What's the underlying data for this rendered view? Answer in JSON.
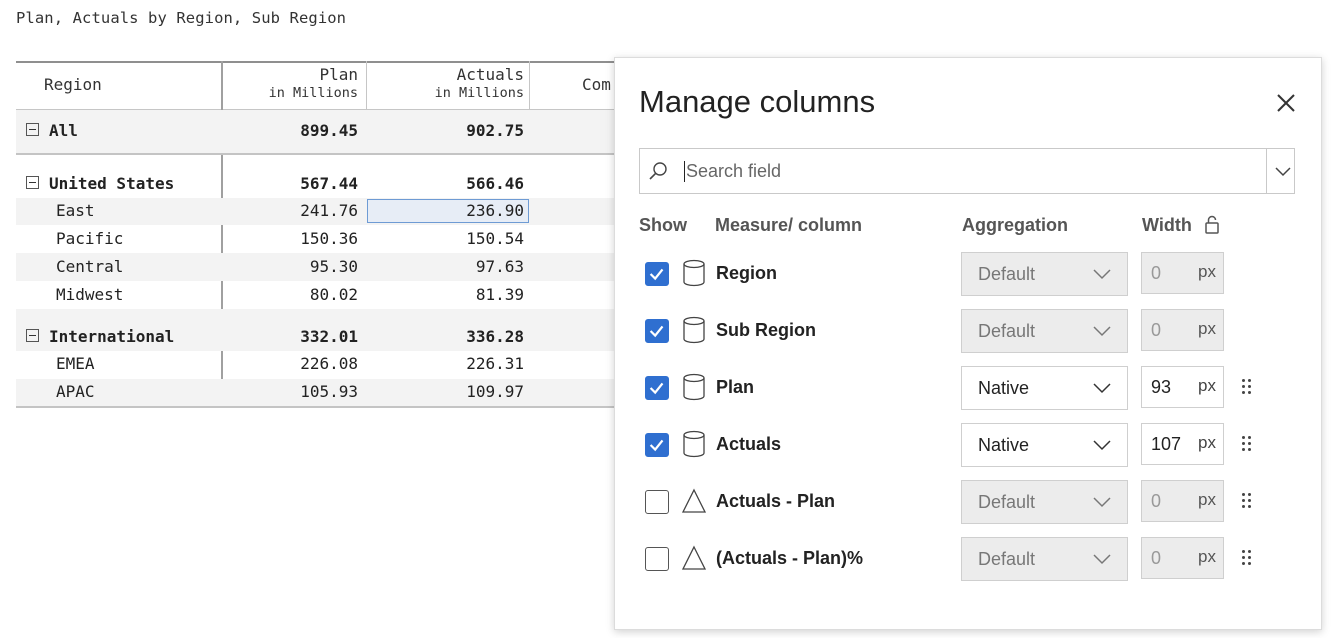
{
  "report": {
    "title": "Plan, Actuals by Region, Sub Region"
  },
  "table": {
    "columns": [
      {
        "label": "Region",
        "sub": ""
      },
      {
        "label": "Plan",
        "sub": "in Millions"
      },
      {
        "label": "Actuals",
        "sub": "in Millions"
      },
      {
        "label": "Com",
        "sub": ""
      }
    ],
    "rows": [
      {
        "name": "All",
        "plan": "899.45",
        "actuals": "902.75"
      },
      {
        "name": "United States",
        "plan": "567.44",
        "actuals": "566.46"
      },
      {
        "name": "East",
        "plan": "241.76",
        "actuals": "236.90"
      },
      {
        "name": "Pacific",
        "plan": "150.36",
        "actuals": "150.54"
      },
      {
        "name": "Central",
        "plan": "95.30",
        "actuals": "97.63"
      },
      {
        "name": "Midwest",
        "plan": "80.02",
        "actuals": "81.39"
      },
      {
        "name": "International",
        "plan": "332.01",
        "actuals": "336.28"
      },
      {
        "name": "EMEA",
        "plan": "226.08",
        "actuals": "226.31"
      },
      {
        "name": "APAC",
        "plan": "105.93",
        "actuals": "109.97"
      }
    ]
  },
  "panel": {
    "title": "Manage columns",
    "search": {
      "placeholder": "Search field",
      "value": ""
    },
    "headers": {
      "show": "Show",
      "measure": "Measure/ column",
      "aggregation": "Aggregation",
      "width": "Width"
    },
    "fields": [
      {
        "name": "Region",
        "checked": true,
        "icon": "cylinder-icon",
        "aggregation": "Default",
        "width": "0",
        "unit": "px",
        "enabled": false
      },
      {
        "name": "Sub Region",
        "checked": true,
        "icon": "cylinder-icon",
        "aggregation": "Default",
        "width": "0",
        "unit": "px",
        "enabled": false
      },
      {
        "name": "Plan",
        "checked": true,
        "icon": "cylinder-icon",
        "aggregation": "Native",
        "width": "93",
        "unit": "px",
        "enabled": true
      },
      {
        "name": "Actuals",
        "checked": true,
        "icon": "cylinder-icon",
        "aggregation": "Native",
        "width": "107",
        "unit": "px",
        "enabled": true
      },
      {
        "name": "Actuals - Plan",
        "checked": false,
        "icon": "triangle-icon",
        "aggregation": "Default",
        "width": "0",
        "unit": "px",
        "enabled": false
      },
      {
        "name": "(Actuals - Plan)%",
        "checked": false,
        "icon": "triangle-icon",
        "aggregation": "Default",
        "width": "0",
        "unit": "px",
        "enabled": false
      }
    ]
  },
  "colors": {
    "checkbox_accent": "#2f6fd0",
    "selected_cell_fill": "#e7edf6",
    "selected_cell_border": "#6e9bd4",
    "disabled_fill": "#ececec"
  }
}
